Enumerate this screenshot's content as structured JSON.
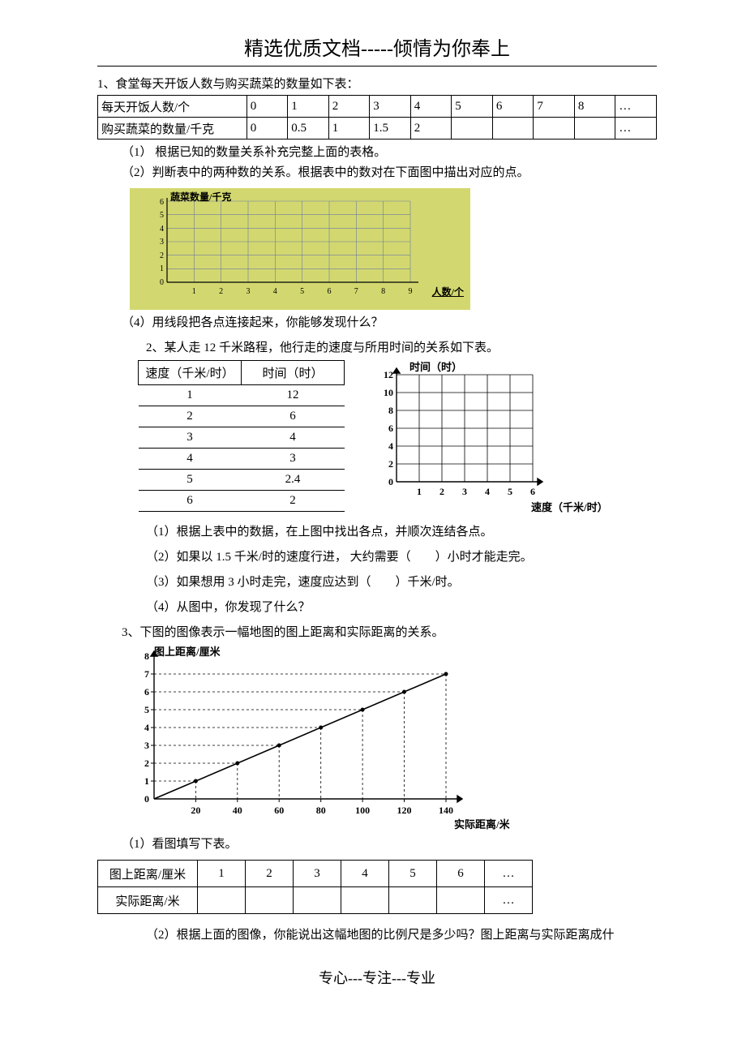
{
  "header": "精选优质文档-----倾情为你奉上",
  "footer": "专心---专注---专业",
  "q1": {
    "intro": "1、食堂每天开饭人数与购买蔬菜的数量如下表：",
    "row1_label": "每天开饭人数/个",
    "row1_vals": [
      "0",
      "1",
      "2",
      "3",
      "4",
      "5",
      "6",
      "7",
      "8",
      "…"
    ],
    "row2_label": "购买蔬菜的数量/千克",
    "row2_vals": [
      "0",
      "0.5",
      "1",
      "1.5",
      "2",
      "",
      "",
      "",
      "",
      "…"
    ],
    "p1": "（1） 根据已知的数量关系补充完整上面的表格。",
    "p2": "（2）判断表中的两种数的关系。根据表中的数对在下面图中描出对应的点。",
    "p4": "（4）用线段把各点连接起来，你能够发现什么？",
    "ylabel": "蔬菜数量/千克",
    "xlabel": "人数/个"
  },
  "q2": {
    "intro": "2、某人走 12 千米路程，他行走的速度与所用时间的关系如下表。",
    "hdr1": "速度（千米/时）",
    "hdr2": "时间（时）",
    "rows": [
      {
        "s": "1",
        "t": "12"
      },
      {
        "s": "2",
        "t": "6"
      },
      {
        "s": "3",
        "t": "4"
      },
      {
        "s": "4",
        "t": "3"
      },
      {
        "s": "5",
        "t": "2.4"
      },
      {
        "s": "6",
        "t": "2"
      }
    ],
    "ylabel": "时间（时）",
    "xlabel": "速度（千米/时）",
    "p1": "（1）根据上表中的数据，在上图中找出各点，并顺次连结各点。",
    "p2": "（2）如果以 1.5 千米/时的速度行进， 大约需要（　　）小时才能走完。",
    "p3": "（3）如果想用 3 小时走完，速度应达到（　　）千米/时。",
    "p4": "（4）从图中，你发现了什么？"
  },
  "q3": {
    "intro": "3、下图的图像表示一幅地图的图上距离和实际距离的关系。",
    "ylabel": "图上距离/厘米",
    "xlabel": "实际距离/米",
    "p1": "（1）看图填写下表。",
    "row1_label": "图上距离/厘米",
    "row1_vals": [
      "1",
      "2",
      "3",
      "4",
      "5",
      "6",
      "…"
    ],
    "row2_label": "实际距离/米",
    "row2_vals": [
      "",
      "",
      "",
      "",
      "",
      "",
      "…"
    ],
    "p2": "（2）根据上面的图像，你能说出这幅地图的比例尺是多少吗？图上距离与实际距离成什"
  },
  "chart_data": [
    {
      "type": "scatter",
      "title": "Q1 蔬菜数量 vs 人数 空白网格",
      "xlabel": "人数/个",
      "ylabel": "蔬菜数量/千克",
      "xlim": [
        0,
        9
      ],
      "ylim": [
        0,
        6
      ],
      "x_ticks": [
        0,
        1,
        2,
        3,
        4,
        5,
        6,
        7,
        8,
        9
      ],
      "y_ticks": [
        1,
        2,
        3,
        4,
        5,
        6
      ],
      "series": []
    },
    {
      "type": "scatter",
      "title": "Q2 时间 vs 速度 空白网格",
      "xlabel": "速度（千米/时）",
      "ylabel": "时间（时）",
      "xlim": [
        0,
        6
      ],
      "ylim": [
        0,
        12
      ],
      "x_ticks": [
        1,
        2,
        3,
        4,
        5,
        6
      ],
      "y_ticks": [
        2,
        4,
        6,
        8,
        10,
        12
      ],
      "series": []
    },
    {
      "type": "line",
      "title": "Q3 图上距离 vs 实际距离",
      "xlabel": "实际距离/米",
      "ylabel": "图上距离/厘米",
      "xlim": [
        0,
        140
      ],
      "ylim": [
        0,
        8
      ],
      "x_ticks": [
        0,
        20,
        40,
        60,
        80,
        100,
        120,
        140
      ],
      "y_ticks": [
        1,
        2,
        3,
        4,
        5,
        6,
        7,
        8
      ],
      "series": [
        {
          "name": "line",
          "x": [
            0,
            20,
            40,
            60,
            80,
            100,
            120,
            140
          ],
          "y": [
            0,
            1,
            2,
            3,
            4,
            5,
            6,
            7
          ]
        }
      ]
    }
  ]
}
